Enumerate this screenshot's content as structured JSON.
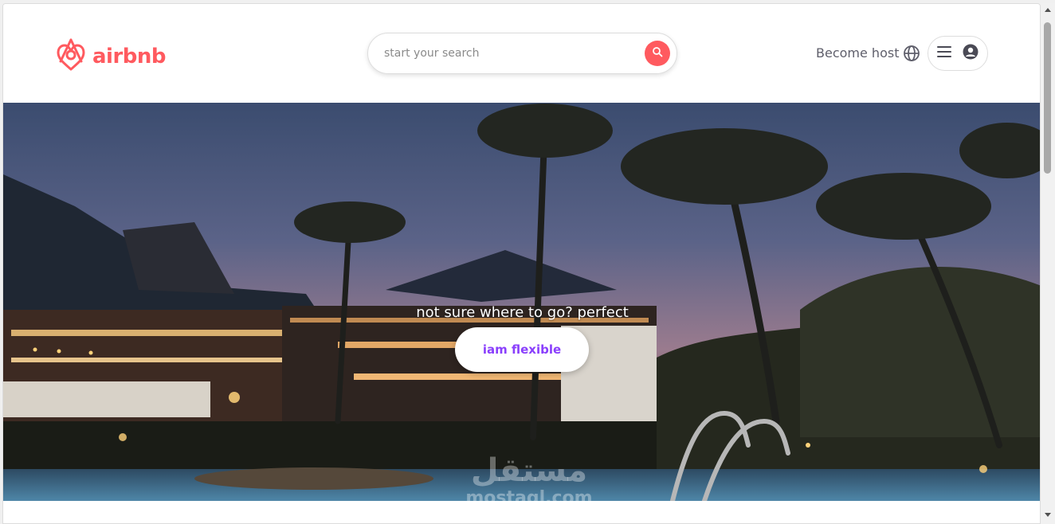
{
  "header": {
    "logo_text": "airbnb",
    "search_placeholder": "start your search",
    "become_host_label": "Become host",
    "icons": {
      "logo": "airbnb-logo-icon",
      "search": "search-icon",
      "globe": "globe-icon",
      "menu": "hamburger-menu-icon",
      "user": "user-avatar-icon"
    }
  },
  "hero": {
    "tagline": "not sure where to go? perfect",
    "cta_label": "iam flexible"
  },
  "watermark": {
    "arabic": "مستقل",
    "latin": "mostaql.com"
  },
  "colors": {
    "brand": "#ff5a5f",
    "cta_text": "#8a3ffc",
    "host_text": "#5f5f6b"
  }
}
